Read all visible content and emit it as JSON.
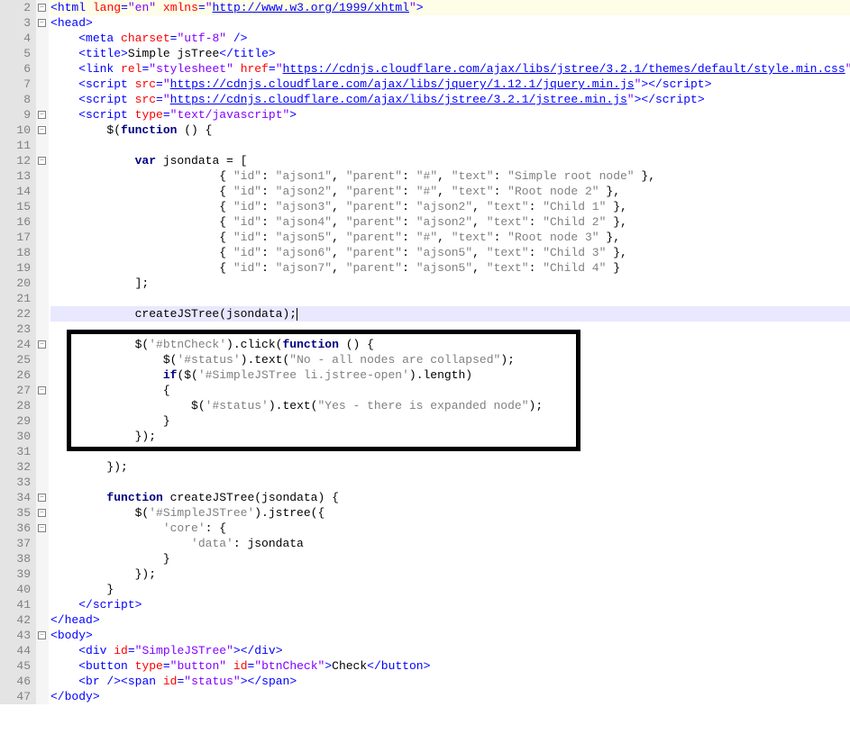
{
  "gutter": {
    "start": 2,
    "end": 47
  },
  "fold_markers": [
    {
      "line": 2,
      "sym": "−"
    },
    {
      "line": 3,
      "sym": "−"
    },
    {
      "line": 9,
      "sym": "−"
    },
    {
      "line": 10,
      "sym": "−"
    },
    {
      "line": 12,
      "sym": "−"
    },
    {
      "line": 24,
      "sym": "−"
    },
    {
      "line": 27,
      "sym": "−"
    },
    {
      "line": 34,
      "sym": "−"
    },
    {
      "line": 35,
      "sym": "−"
    },
    {
      "line": 36,
      "sym": "−"
    },
    {
      "line": 43,
      "sym": "−"
    }
  ],
  "code": {
    "l2": {
      "pre": "<",
      "tag": "html",
      "sp": " ",
      "a1": "lang",
      "eq1": "=",
      "v1": "\"en\"",
      "sp2": " ",
      "a2": "xmlns",
      "eq2": "=",
      "v2_open": "\"",
      "url": "http://www.w3.org/1999/xhtml",
      "v2_close": "\"",
      "end": ">"
    },
    "l3": {
      "pre": "<",
      "tag": "head",
      "end": ">"
    },
    "l4": {
      "pre": "    <",
      "tag": "meta",
      "sp": " ",
      "a1": "charset",
      "eq": "=",
      "v1": "\"utf-8\"",
      "end": " />"
    },
    "l5": {
      "pre": "    <",
      "tag": "title",
      "end1": ">",
      "text": "Simple jsTree",
      "pre2": "</",
      "tag2": "title",
      "end2": ">"
    },
    "l6": {
      "pre": "    <",
      "tag": "link",
      "sp": " ",
      "a1": "rel",
      "eq1": "=",
      "v1": "\"stylesheet\"",
      "sp2": " ",
      "a2": "href",
      "eq2": "=",
      "v2o": "\"",
      "url": "https://cdnjs.cloudflare.com/ajax/libs/jstree/3.2.1/themes/default/style.min.css",
      "v2c": "\"",
      "end": " />"
    },
    "l7": {
      "pre": "    <",
      "tag": "script",
      "sp": " ",
      "a1": "src",
      "eq": "=",
      "v1o": "\"",
      "url": "https://cdnjs.cloudflare.com/ajax/libs/jquery/1.12.1/jquery.min.js",
      "v1c": "\"",
      "end1": ">",
      "pre2": "</",
      "tag2": "script",
      "end2": ">"
    },
    "l8": {
      "pre": "    <",
      "tag": "script",
      "sp": " ",
      "a1": "src",
      "eq": "=",
      "v1o": "\"",
      "url": "https://cdnjs.cloudflare.com/ajax/libs/jstree/3.2.1/jstree.min.js",
      "v1c": "\"",
      "end1": ">",
      "pre2": "</",
      "tag2": "script",
      "end2": ">"
    },
    "l9": {
      "pre": "    <",
      "tag": "script",
      "sp": " ",
      "a1": "type",
      "eq": "=",
      "v1": "\"text/javascript\"",
      "end": ">"
    },
    "l10": {
      "indent": "        ",
      "d": "$(",
      "kw": "function",
      "rest": " () {"
    },
    "l11": "",
    "l12": {
      "indent": "            ",
      "kw": "var",
      "rest": " jsondata = ["
    },
    "l13": {
      "indent": "                        { ",
      "k1": "\"id\"",
      "c1": ": ",
      "v1": "\"ajson1\"",
      "c2": ", ",
      "k2": "\"parent\"",
      "c3": ": ",
      "v2": "\"#\"",
      "c4": ", ",
      "k3": "\"text\"",
      "c5": ": ",
      "v3": "\"Simple root node\"",
      "end": " },"
    },
    "l14": {
      "indent": "                        { ",
      "k1": "\"id\"",
      "c1": ": ",
      "v1": "\"ajson2\"",
      "c2": ", ",
      "k2": "\"parent\"",
      "c3": ": ",
      "v2": "\"#\"",
      "c4": ", ",
      "k3": "\"text\"",
      "c5": ": ",
      "v3": "\"Root node 2\"",
      "end": " },"
    },
    "l15": {
      "indent": "                        { ",
      "k1": "\"id\"",
      "c1": ": ",
      "v1": "\"ajson3\"",
      "c2": ", ",
      "k2": "\"parent\"",
      "c3": ": ",
      "v2": "\"ajson2\"",
      "c4": ", ",
      "k3": "\"text\"",
      "c5": ": ",
      "v3": "\"Child 1\"",
      "end": " },"
    },
    "l16": {
      "indent": "                        { ",
      "k1": "\"id\"",
      "c1": ": ",
      "v1": "\"ajson4\"",
      "c2": ", ",
      "k2": "\"parent\"",
      "c3": ": ",
      "v2": "\"ajson2\"",
      "c4": ", ",
      "k3": "\"text\"",
      "c5": ": ",
      "v3": "\"Child 2\"",
      "end": " },"
    },
    "l17": {
      "indent": "                        { ",
      "k1": "\"id\"",
      "c1": ": ",
      "v1": "\"ajson5\"",
      "c2": ", ",
      "k2": "\"parent\"",
      "c3": ": ",
      "v2": "\"#\"",
      "c4": ", ",
      "k3": "\"text\"",
      "c5": ": ",
      "v3": "\"Root node 3\"",
      "end": " },"
    },
    "l18": {
      "indent": "                        { ",
      "k1": "\"id\"",
      "c1": ": ",
      "v1": "\"ajson6\"",
      "c2": ", ",
      "k2": "\"parent\"",
      "c3": ": ",
      "v2": "\"ajson5\"",
      "c4": ", ",
      "k3": "\"text\"",
      "c5": ": ",
      "v3": "\"Child 3\"",
      "end": " },"
    },
    "l19": {
      "indent": "                        { ",
      "k1": "\"id\"",
      "c1": ": ",
      "v1": "\"ajson7\"",
      "c2": ", ",
      "k2": "\"parent\"",
      "c3": ": ",
      "v2": "\"ajson5\"",
      "c4": ", ",
      "k3": "\"text\"",
      "c5": ": ",
      "v3": "\"Child 4\"",
      "end": " }"
    },
    "l20": {
      "text": "            ];"
    },
    "l21": "",
    "l22": {
      "text": "            createJSTree(jsondata);"
    },
    "l23": "",
    "l24": {
      "indent": "            $(",
      "s1": "'#btnCheck'",
      "mid": ").click(",
      "kw": "function",
      "rest": " () {"
    },
    "l25": {
      "indent": "                $(",
      "s1": "'#status'",
      "mid": ").text(",
      "s2": "\"No - all nodes are collapsed\"",
      "rest": ");"
    },
    "l26": {
      "indent": "                ",
      "kw": "if",
      "mid": "($(",
      "s1": "'#SimpleJSTree li.jstree-open'",
      "rest": ").length)"
    },
    "l27": {
      "text": "                {"
    },
    "l28": {
      "indent": "                    $(",
      "s1": "'#status'",
      "mid": ").text(",
      "s2": "\"Yes - there is expanded node\"",
      "rest": ");"
    },
    "l29": {
      "text": "                }"
    },
    "l30": {
      "text": "            });"
    },
    "l31": "",
    "l32": {
      "text": "        });"
    },
    "l33": "",
    "l34": {
      "indent": "        ",
      "kw": "function",
      "rest": " createJSTree(jsondata) {"
    },
    "l35": {
      "indent": "            $(",
      "s1": "'#SimpleJSTree'",
      "rest": ").jstree({"
    },
    "l36": {
      "indent": "                ",
      "s1": "'core'",
      "rest": ": {"
    },
    "l37": {
      "indent": "                    ",
      "s1": "'data'",
      "rest": ": jsondata"
    },
    "l38": {
      "text": "                }"
    },
    "l39": {
      "text": "            });"
    },
    "l40": {
      "text": "        }"
    },
    "l41": {
      "pre": "    </",
      "tag": "script",
      "end": ">"
    },
    "l42": {
      "pre": "</",
      "tag": "head",
      "end": ">"
    },
    "l43": {
      "pre": "<",
      "tag": "body",
      "end": ">"
    },
    "l44": {
      "pre": "    <",
      "tag": "div",
      "sp": " ",
      "a1": "id",
      "eq": "=",
      "v1": "\"SimpleJSTree\"",
      "end1": ">",
      "pre2": "</",
      "tag2": "div",
      "end2": ">"
    },
    "l45": {
      "pre": "    <",
      "tag": "button",
      "sp": " ",
      "a1": "type",
      "eq1": "=",
      "v1": "\"button\"",
      "sp2": " ",
      "a2": "id",
      "eq2": "=",
      "v2": "\"btnCheck\"",
      "end1": ">",
      "text": "Check",
      "pre2": "</",
      "tag2": "button",
      "end2": ">"
    },
    "l46": {
      "pre": "    <",
      "tag": "br",
      "end1": " />",
      "pre2": "<",
      "tag2": "span",
      "sp": " ",
      "a1": "id",
      "eq": "=",
      "v2": "\"status\"",
      "end2": ">",
      "pre3": "</",
      "tag3": "span",
      "end3": ">"
    },
    "l47": {
      "pre": "</",
      "tag": "body",
      "end": ">"
    }
  },
  "highlight_box": {
    "top_line": 24,
    "bottom_line": 30
  }
}
